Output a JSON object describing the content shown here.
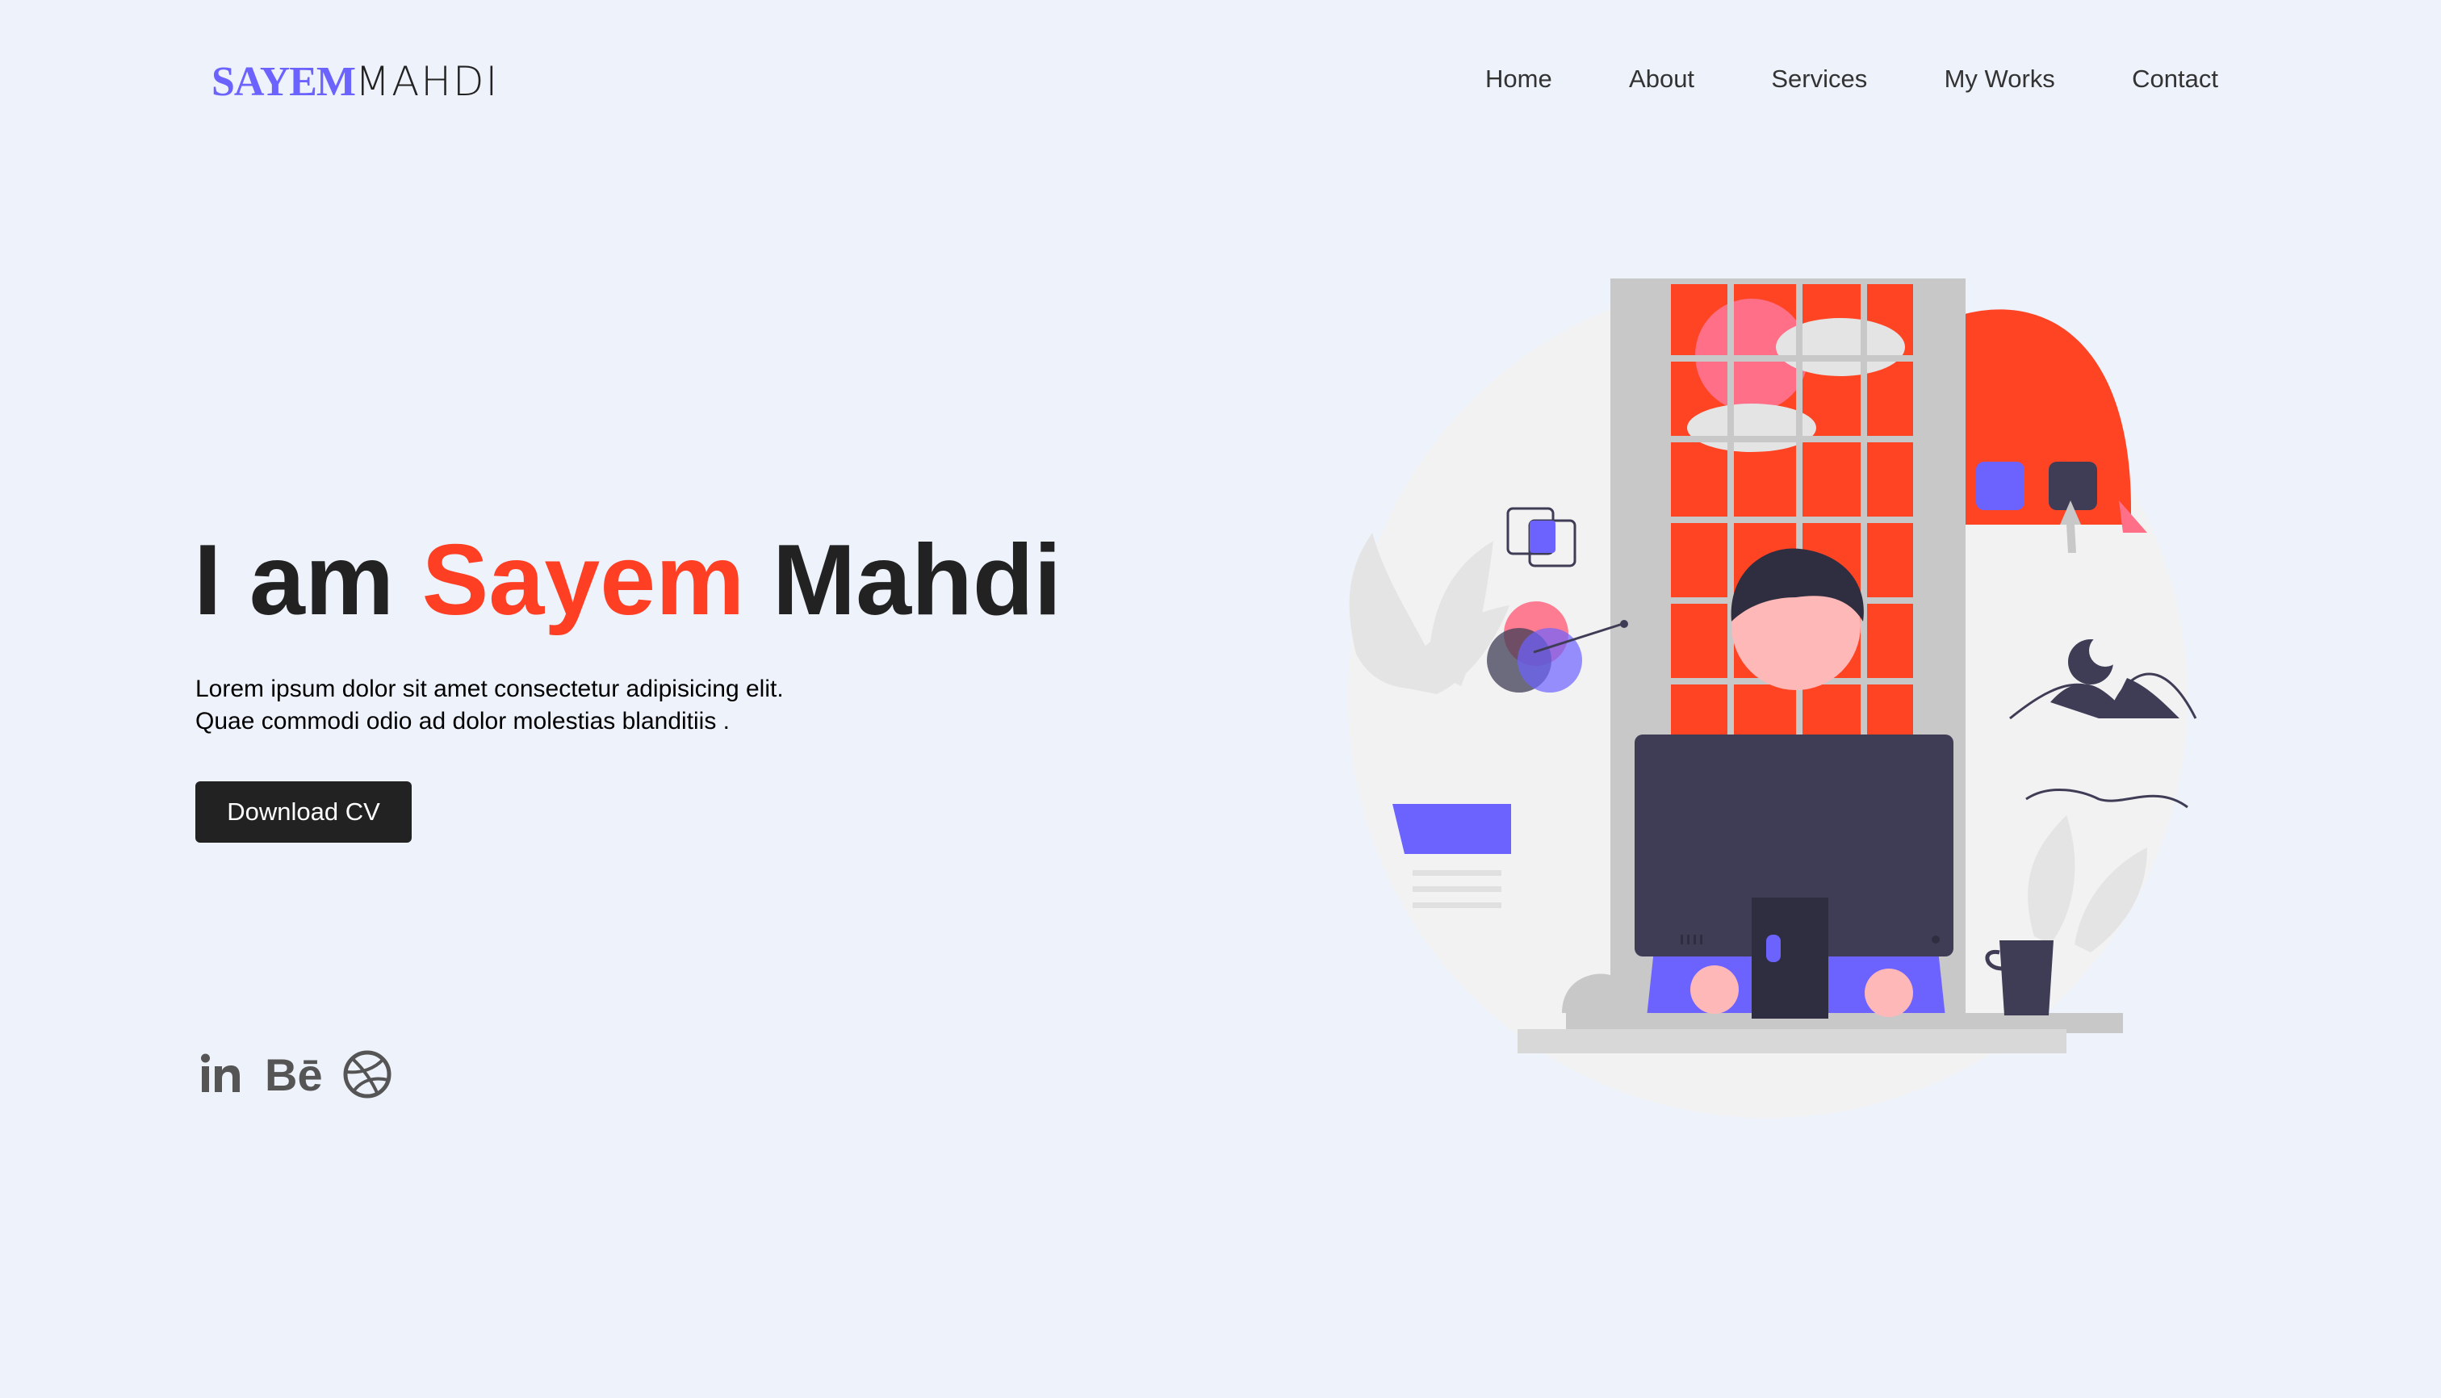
{
  "header": {
    "logo_first": "SAYEM",
    "logo_last": "MAHDI",
    "nav": [
      "Home",
      "About",
      "Services",
      "My Works",
      "Contact"
    ]
  },
  "hero": {
    "title_prefix": "I am ",
    "title_highlight": "Sayem",
    "title_suffix": " Mahdi",
    "subtitle_line1": "Lorem ipsum dolor sit amet consectetur adipisicing elit.",
    "subtitle_line2": "Quae commodi odio ad dolor molestias blanditiis .",
    "cta_label": "Download CV"
  },
  "socials": [
    "linkedin-icon",
    "behance-icon",
    "dribbble-icon"
  ],
  "colors": {
    "background": "#eef2fb",
    "accent": "#ff3f24",
    "brand": "#6c63ff",
    "text": "#222222",
    "button": "#222222"
  }
}
